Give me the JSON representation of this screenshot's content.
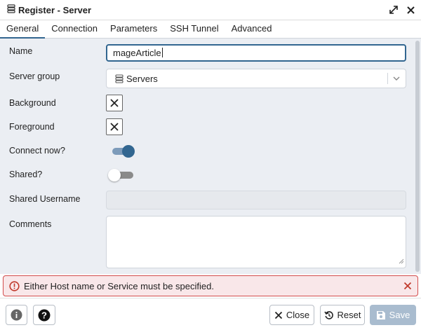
{
  "window": {
    "title": "Register - Server"
  },
  "tabs": [
    {
      "label": "General",
      "active": true
    },
    {
      "label": "Connection",
      "active": false
    },
    {
      "label": "Parameters",
      "active": false
    },
    {
      "label": "SSH Tunnel",
      "active": false
    },
    {
      "label": "Advanced",
      "active": false
    }
  ],
  "form": {
    "name": {
      "label": "Name",
      "value": "mageArticle"
    },
    "server_group": {
      "label": "Server group",
      "value": "Servers"
    },
    "background": {
      "label": "Background"
    },
    "foreground": {
      "label": "Foreground"
    },
    "connect_now": {
      "label": "Connect now?",
      "checked": true
    },
    "shared": {
      "label": "Shared?",
      "checked": false
    },
    "shared_username": {
      "label": "Shared Username",
      "value": ""
    },
    "comments": {
      "label": "Comments",
      "value": ""
    }
  },
  "error": {
    "message": "Either Host name or Service must be specified."
  },
  "footer": {
    "close_label": "Close",
    "reset_label": "Reset",
    "save_label": "Save"
  },
  "colors": {
    "accent": "#326690",
    "error_border": "#d24c4c",
    "error_bg": "#f9e7e9",
    "save_disabled": "#a9bccf"
  }
}
